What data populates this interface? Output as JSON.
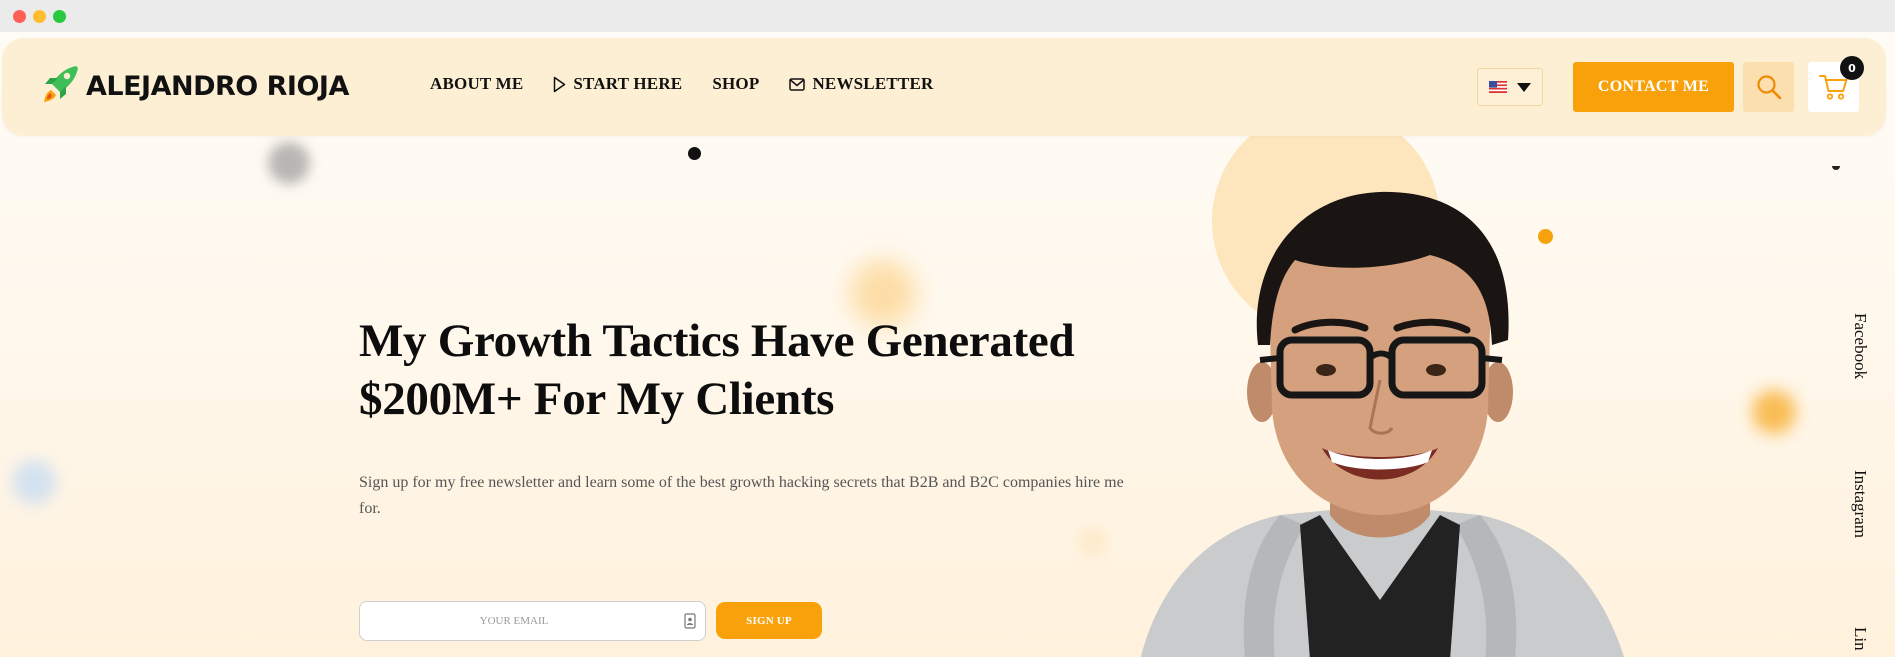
{
  "brand": {
    "name": "ALEJANDRO RIOJA",
    "logo_icon": "rocket-icon",
    "accent_color": "#f9a10a",
    "logo_color": "#3fbf58"
  },
  "nav": {
    "items": [
      {
        "label": "ABOUT ME",
        "icon": ""
      },
      {
        "label": "START HERE",
        "icon": "play-outline-icon"
      },
      {
        "label": "SHOP",
        "icon": ""
      },
      {
        "label": "NEWSLETTER",
        "icon": "envelope-icon"
      }
    ]
  },
  "language": {
    "selected_icon": "us-flag-icon"
  },
  "header_actions": {
    "contact_label": "CONTACT ME",
    "search_icon": "search-icon",
    "cart_icon": "cart-icon",
    "cart_count": "0"
  },
  "hero": {
    "title_line1": "My Growth Tactics Have Generated",
    "title_line2": "$200M+ For My Clients",
    "subtitle": "Sign up for my free newsletter and learn some of the best growth hacking secrets that B2B and B2C companies hire me for.",
    "email_placeholder": "YOUR EMAIL",
    "signup_label": "SIGN UP"
  },
  "social": {
    "facebook": "Facebook",
    "instagram": "Instagram",
    "linkedin": "Lin"
  }
}
